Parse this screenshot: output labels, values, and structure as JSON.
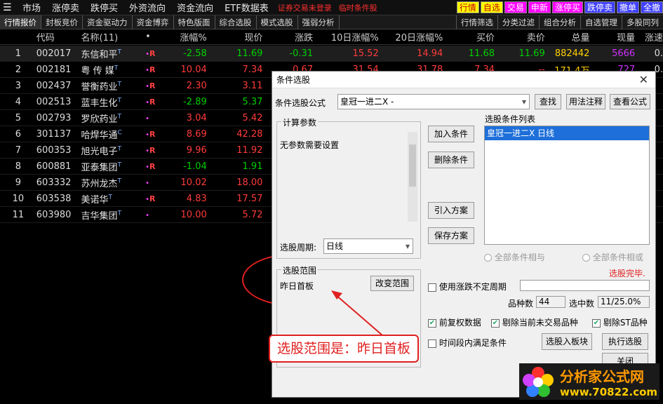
{
  "menubar": {
    "items": [
      "市场",
      "涨停卖",
      "跌停买",
      "外资流向",
      "资金流向",
      "ETF数据表"
    ],
    "warnings": [
      "证券交易未登录",
      "临时条件股"
    ],
    "right_buttons": [
      {
        "label": "行情",
        "style": "b-y"
      },
      {
        "label": "自选",
        "style": "b-y"
      },
      {
        "label": "交易",
        "style": "b-p"
      },
      {
        "label": "申新",
        "style": "b-p"
      },
      {
        "label": "涨停买",
        "style": "b-p"
      },
      {
        "label": "跌停卖",
        "style": "b-b"
      },
      {
        "label": "撤单",
        "style": "b-b"
      },
      {
        "label": "全撤",
        "style": "b-b"
      }
    ]
  },
  "tabs": {
    "left": [
      "行情报价",
      "封板竞价",
      "资金驱动力",
      "资金博弈",
      "特色版面",
      "综合选股",
      "模式选股",
      "强弱分析"
    ],
    "right": [
      "行情筛选",
      "分类过滤",
      "组合分析",
      "自选管理",
      "多股同列"
    ]
  },
  "grid": {
    "headers": [
      "",
      "代码",
      "名称(11)",
      "•",
      "涨幅%",
      "现价",
      "涨跌",
      "10日涨幅%",
      "20日涨幅%",
      "买价",
      "卖价",
      "总量",
      "现量",
      "涨速"
    ],
    "rows": [
      {
        "idx": "1",
        "code": "002017",
        "name": "东信和平",
        "sup": "T",
        "flag": "R",
        "pct": "-2.58",
        "price": "11.69",
        "chg": "-0.31",
        "d10": "15.52",
        "d20": "14.94",
        "bid": "11.68",
        "ask": "11.69",
        "vol": "882442",
        "cur": "5666",
        "up": "0.",
        "pct_c": "green",
        "price_c": "green",
        "chg_c": "green",
        "vol_c": "yellow",
        "cur_c": "purple"
      },
      {
        "idx": "2",
        "code": "002181",
        "name": "粤 传 媒",
        "sup": "T",
        "flag": "R",
        "pct": "10.04",
        "price": "7.34",
        "chg": "0.67",
        "d10": "31.54",
        "d20": "31.78",
        "bid": "7.34",
        "ask": "--",
        "vol": "171.4万",
        "cur": "727",
        "up": "0.",
        "pct_c": "red",
        "price_c": "red",
        "chg_c": "red",
        "vol_c": "yellow",
        "cur_c": "purple"
      },
      {
        "idx": "3",
        "code": "002437",
        "name": "誉衡药业",
        "sup": "T",
        "flag": "R",
        "pct": "2.30",
        "price": "3.11",
        "chg": "",
        "d10": "",
        "d20": "",
        "bid": "",
        "ask": "",
        "vol": "",
        "cur": "",
        "up": "",
        "pct_c": "red",
        "price_c": "red",
        "chg_c": "red",
        "vol_c": "yellow",
        "cur_c": "purple"
      },
      {
        "idx": "4",
        "code": "002513",
        "name": "蓝丰生化",
        "sup": "T",
        "flag": "R",
        "pct": "-2.89",
        "price": "5.37",
        "chg": "",
        "d10": "",
        "d20": "",
        "bid": "",
        "ask": "",
        "vol": "",
        "cur": "",
        "up": "",
        "pct_c": "green",
        "price_c": "green",
        "chg_c": "green",
        "vol_c": "yellow",
        "cur_c": "purple"
      },
      {
        "idx": "5",
        "code": "002793",
        "name": "罗欣药业",
        "sup": "T",
        "flag": "",
        "pct": "3.04",
        "price": "5.42",
        "chg": "",
        "d10": "",
        "d20": "",
        "bid": "",
        "ask": "",
        "vol": "",
        "cur": "",
        "up": "",
        "pct_c": "red",
        "price_c": "red",
        "chg_c": "red",
        "vol_c": "yellow",
        "cur_c": "purple"
      },
      {
        "idx": "6",
        "code": "301137",
        "name": "哈焊华通",
        "sup": "C",
        "flag": "R",
        "pct": "8.69",
        "price": "42.28",
        "chg": "",
        "d10": "",
        "d20": "",
        "bid": "",
        "ask": "",
        "vol": "",
        "cur": "",
        "up": "",
        "pct_c": "red",
        "price_c": "red",
        "chg_c": "red",
        "vol_c": "yellow",
        "cur_c": "purple",
        "name_c": "red"
      },
      {
        "idx": "7",
        "code": "600353",
        "name": "旭光电子",
        "sup": "T",
        "flag": "R",
        "pct": "9.96",
        "price": "11.92",
        "chg": "",
        "d10": "",
        "d20": "",
        "bid": "",
        "ask": "",
        "vol": "",
        "cur": "",
        "up": "",
        "pct_c": "red",
        "price_c": "red",
        "chg_c": "red",
        "vol_c": "yellow",
        "cur_c": "purple"
      },
      {
        "idx": "8",
        "code": "600881",
        "name": "亚泰集团",
        "sup": "T",
        "flag": "R",
        "pct": "-1.04",
        "price": "1.91",
        "chg": "",
        "d10": "",
        "d20": "",
        "bid": "",
        "ask": "",
        "vol": "",
        "cur": "",
        "up": "",
        "pct_c": "green",
        "price_c": "green",
        "chg_c": "green",
        "vol_c": "yellow",
        "cur_c": "purple"
      },
      {
        "idx": "9",
        "code": "603332",
        "name": "苏州龙杰",
        "sup": "T",
        "flag": "",
        "pct": "10.02",
        "price": "18.00",
        "chg": "",
        "d10": "",
        "d20": "",
        "bid": "",
        "ask": "",
        "vol": "",
        "cur": "",
        "up": "",
        "pct_c": "red",
        "price_c": "red",
        "chg_c": "red",
        "vol_c": "yellow",
        "cur_c": "purple"
      },
      {
        "idx": "10",
        "code": "603538",
        "name": "美诺华",
        "sup": "T",
        "flag": "R",
        "pct": "4.83",
        "price": "17.57",
        "chg": "",
        "d10": "",
        "d20": "",
        "bid": "",
        "ask": "",
        "vol": "",
        "cur": "",
        "up": "",
        "pct_c": "red",
        "price_c": "red",
        "chg_c": "red",
        "vol_c": "yellow",
        "cur_c": "purple"
      },
      {
        "idx": "11",
        "code": "603980",
        "name": "吉华集团",
        "sup": "T",
        "flag": "",
        "pct": "10.00",
        "price": "5.72",
        "chg": "",
        "d10": "",
        "d20": "",
        "bid": "",
        "ask": "",
        "vol": "",
        "cur": "",
        "up": "",
        "pct_c": "red",
        "price_c": "red",
        "chg_c": "red",
        "vol_c": "yellow",
        "cur_c": "purple"
      }
    ]
  },
  "dialog": {
    "title": "条件选股",
    "close": "✕",
    "formula_label": "条件选股公式",
    "formula_value": "皇冠一进二X  -",
    "btn_find": "查找",
    "btn_usage": "用法注释",
    "btn_view": "查看公式",
    "params_title": "计算参数",
    "params_text": "无参数需要设置",
    "period_label": "选股周期:",
    "period_value": "日线",
    "list_title": "选股条件列表",
    "list_items": [
      "皇冠一进二X  日线"
    ],
    "btn_add": "加入条件",
    "btn_delete": "删除条件",
    "btn_import": "引入方案",
    "btn_save": "保存方案",
    "radio_and": "全部条件相与",
    "radio_or": "全部条件相或",
    "status": "选股完毕.",
    "range_title": "选股范围",
    "range_value": "昨日首板",
    "btn_change_range": "改变范围",
    "chk_use_period": "使用涨跌不定周期",
    "count_label": "品种数",
    "count_value": "44",
    "selected_label": "选中数",
    "selected_value": "11/25.0%",
    "chk_prefq": "前复权数据",
    "chk_exclude_untraded": "剔除当前未交易品种",
    "chk_exclude_st": "剔除ST品种",
    "chk_time_range": "时间段内满足条件",
    "btn_to_block": "选股入板块",
    "btn_run": "执行选股",
    "btn_close": "关闭"
  },
  "annotation": {
    "callout": "选股范围是：昨日首板"
  },
  "watermark": {
    "title": "分析家公式网",
    "url": "www.70822.com"
  }
}
